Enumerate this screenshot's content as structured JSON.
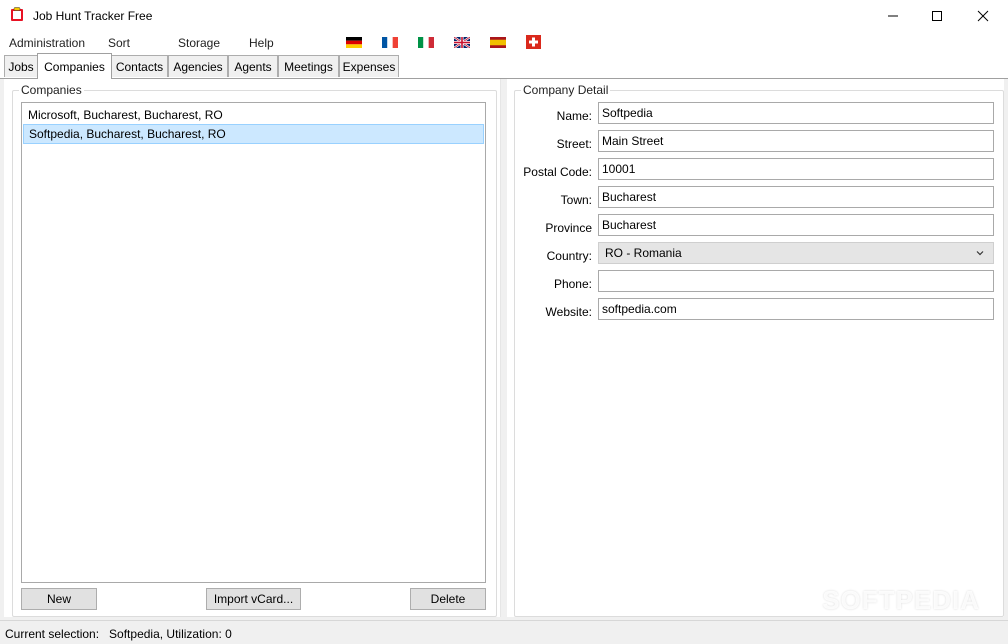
{
  "window": {
    "title": "Job Hunt Tracker Free"
  },
  "menu": [
    "Administration",
    "Sort",
    "Storage",
    "Help"
  ],
  "flags": [
    {
      "name": "german-flag-icon",
      "colors": [
        "#000000",
        "#dd0000",
        "#ffce00"
      ]
    },
    {
      "name": "french-flag-icon",
      "colors": [
        "#0055a4",
        "#ffffff",
        "#ef4135"
      ]
    },
    {
      "name": "italian-flag-icon",
      "colors": [
        "#009246",
        "#ffffff",
        "#ce2b37"
      ]
    },
    {
      "name": "uk-flag-icon",
      "colors": [
        "#012169",
        "#ffffff",
        "#c8102e"
      ]
    },
    {
      "name": "spanish-flag-icon",
      "colors": [
        "#aa151b",
        "#f1bf00",
        "#aa151b"
      ]
    },
    {
      "name": "swiss-flag-icon",
      "colors": [
        "#da291c",
        "#ffffff"
      ]
    }
  ],
  "tabs": [
    "Jobs",
    "Companies",
    "Contacts",
    "Agencies",
    "Agents",
    "Meetings",
    "Expenses"
  ],
  "active_tab": "Companies",
  "companies": {
    "group_label": "Companies",
    "items": [
      {
        "label": "Microsoft, Bucharest, Bucharest, RO",
        "selected": false
      },
      {
        "label": "Softpedia, Bucharest, Bucharest, RO",
        "selected": true
      }
    ],
    "buttons": {
      "new": "New",
      "import": "Import vCard...",
      "delete": "Delete"
    }
  },
  "detail": {
    "group_label": "Company Detail",
    "fields": [
      {
        "label": "Name:",
        "value": "Softpedia"
      },
      {
        "label": "Street:",
        "value": "Main Street"
      },
      {
        "label": "Postal Code:",
        "value": "10001"
      },
      {
        "label": "Town:",
        "value": "Bucharest"
      },
      {
        "label": "Province",
        "value": "Bucharest"
      },
      {
        "label": "Country:",
        "value": "RO - Romania",
        "type": "select"
      },
      {
        "label": "Phone:",
        "value": ""
      },
      {
        "label": "Website:",
        "value": "softpedia.com"
      }
    ]
  },
  "status": {
    "text": "Current selection:   Softpedia, Utilization: 0"
  },
  "watermark": "SOFTPEDIA",
  "colors": {
    "selection_bg": "#cce8ff",
    "selection_border": "#99d1ff",
    "app_icon": "#e81123"
  }
}
